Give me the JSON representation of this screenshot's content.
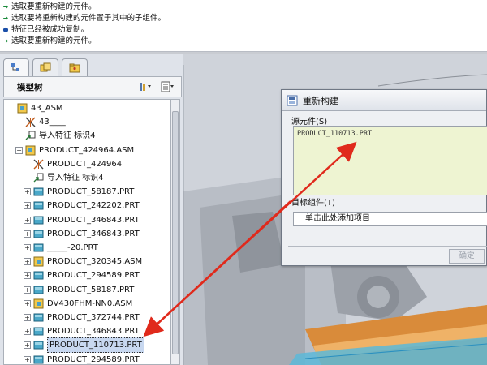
{
  "messages": [
    {
      "icon": "arrow",
      "text": "选取要重新构建的元件。"
    },
    {
      "icon": "arrow",
      "text": "选取要将重新构建的元件置于其中的子组件。"
    },
    {
      "icon": "dot",
      "text": "特征已经被成功复制。"
    },
    {
      "icon": "arrow",
      "text": "选取要重新构建的元件。"
    }
  ],
  "model_tree": {
    "title": "模型树",
    "items": [
      {
        "label": "43_ASM",
        "type": "asm",
        "expander": ""
      },
      {
        "label": "43____",
        "type": "csys",
        "expander": ""
      },
      {
        "label": "导入特征 标识4",
        "type": "import",
        "expander": ""
      },
      {
        "label": "PRODUCT_424964.ASM",
        "type": "asm",
        "expander": "−"
      },
      {
        "label": "PRODUCT_424964",
        "type": "csys",
        "expander": ""
      },
      {
        "label": "导入特征 标识4",
        "type": "import",
        "expander": ""
      },
      {
        "label": "PRODUCT_58187.PRT",
        "type": "prt",
        "expander": "+"
      },
      {
        "label": "PRODUCT_242202.PRT",
        "type": "prt",
        "expander": "+"
      },
      {
        "label": "PRODUCT_346843.PRT",
        "type": "prt",
        "expander": "+"
      },
      {
        "label": "PRODUCT_346843.PRT",
        "type": "prt",
        "expander": "+"
      },
      {
        "label": "_____-20.PRT",
        "type": "prt",
        "expander": "+"
      },
      {
        "label": "PRODUCT_320345.ASM",
        "type": "asm",
        "expander": "+"
      },
      {
        "label": "PRODUCT_294589.PRT",
        "type": "prt",
        "expander": "+"
      },
      {
        "label": "PRODUCT_58187.PRT",
        "type": "prt",
        "expander": "+"
      },
      {
        "label": "DV430FHM-NN0.ASM",
        "type": "asm",
        "expander": "+"
      },
      {
        "label": "PRODUCT_372744.PRT",
        "type": "prt",
        "expander": "+"
      },
      {
        "label": "PRODUCT_346843.PRT",
        "type": "prt",
        "expander": "+"
      },
      {
        "label": "PRODUCT_110713.PRT",
        "type": "prt",
        "expander": "+",
        "selected": true
      },
      {
        "label": "PRODUCT_294589.PRT",
        "type": "prt",
        "expander": "+"
      }
    ]
  },
  "dialog": {
    "title": "重新构建",
    "source_label": "源元件(S)",
    "source_file": "PRODUCT_110713.PRT",
    "target_label": "目标组件(T)",
    "target_placeholder": "单击此处添加项目",
    "ok_label": "确定"
  },
  "colors": {
    "accent": "#3a6fc4",
    "annotation_arrow": "#e02a1c",
    "source_box_bg": "#eef4d2"
  }
}
